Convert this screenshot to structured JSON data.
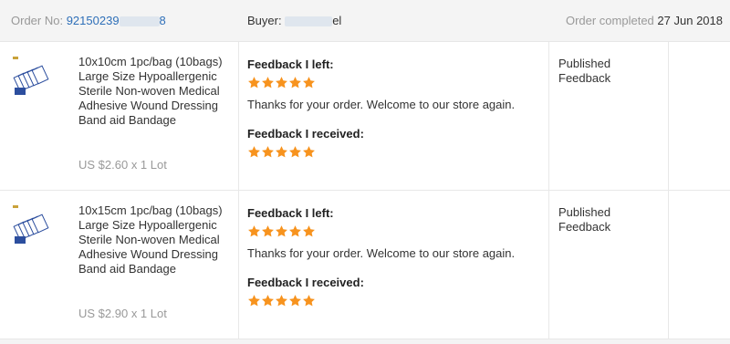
{
  "header": {
    "order_label": "Order No:",
    "order_number": "92150239",
    "order_tail": "8",
    "buyer_label": "Buyer:",
    "buyer_tail": "el",
    "status_label": "Order completed",
    "status_date": "27 Jun 2018"
  },
  "orders": [
    {
      "product": "10x10cm 1pc/bag (10bags) Large Size Hypoallergenic Sterile Non-woven Medical Adhesive Wound Dressing Band aid Bandage",
      "price": "US $2.60 x 1 Lot",
      "feedback_left_title": "Feedback I left:",
      "feedback_left_stars": 5,
      "feedback_left_comment": "Thanks for your order. Welcome to our store again.",
      "feedback_received_title": "Feedback I received:",
      "feedback_received_stars": 5,
      "status_line1": "Published",
      "status_line2": "Feedback"
    },
    {
      "product": "10x15cm 1pc/bag (10bags) Large Size Hypoallergenic Sterile Non-woven Medical Adhesive Wound Dressing Band aid Bandage",
      "price": "US $2.90 x 1 Lot",
      "feedback_left_title": "Feedback I left:",
      "feedback_left_stars": 5,
      "feedback_left_comment": "Thanks for your order. Welcome to our store again.",
      "feedback_received_title": "Feedback I received:",
      "feedback_received_stars": 5,
      "status_line1": "Published",
      "status_line2": "Feedback"
    }
  ],
  "colors": {
    "star": "#f7931e",
    "order_number": "#2e6fb8"
  },
  "icons": {
    "star": "star-icon",
    "product": "product-thumbnail"
  }
}
